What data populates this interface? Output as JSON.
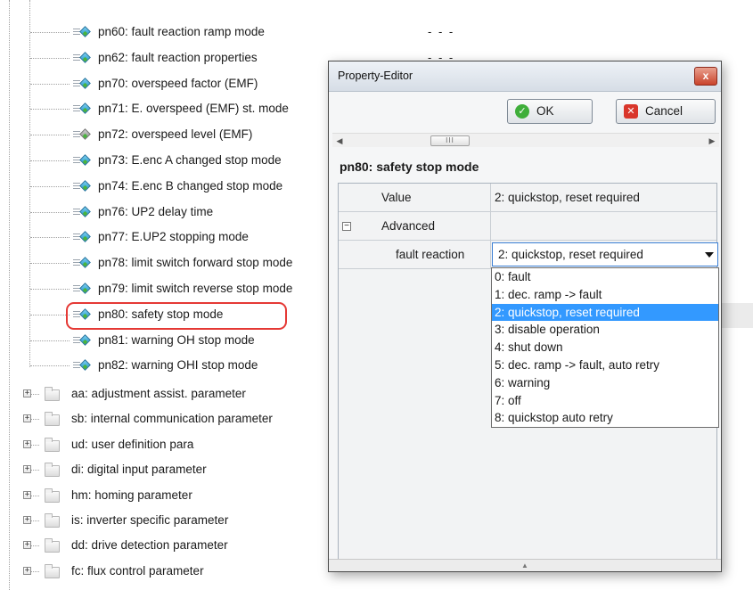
{
  "tree": {
    "param_items": [
      {
        "label": "pn60: fault reaction ramp mode",
        "value": "- - -",
        "icon": "parameter-icon"
      },
      {
        "label": "pn62: fault reaction properties",
        "value": "- - -",
        "icon": "parameter-icon"
      },
      {
        "label": "pn70: overspeed factor (EMF)",
        "icon": "parameter-icon"
      },
      {
        "label": "pn71: E. overspeed (EMF) st. mode",
        "icon": "parameter-icon"
      },
      {
        "label": "pn72: overspeed level (EMF)",
        "icon": "parameter-grey-icon"
      },
      {
        "label": "pn73: E.enc A changed stop mode",
        "icon": "parameter-icon"
      },
      {
        "label": "pn74: E.enc B changed stop mode",
        "icon": "parameter-icon"
      },
      {
        "label": "pn76: UP2 delay time",
        "icon": "parameter-icon"
      },
      {
        "label": "pn77: E.UP2 stopping mode",
        "icon": "parameter-icon"
      },
      {
        "label": "pn78: limit switch forward stop mode",
        "icon": "parameter-icon"
      },
      {
        "label": "pn79: limit switch reverse stop mode",
        "icon": "parameter-icon"
      },
      {
        "label": "pn80: safety stop mode",
        "icon": "parameter-icon",
        "highlighted": true
      },
      {
        "label": "pn81: warning OH stop mode",
        "icon": "parameter-icon"
      },
      {
        "label": "pn82: warning OHI stop mode",
        "icon": "parameter-icon"
      }
    ],
    "groups": [
      {
        "label": "aa: adjustment assist. parameter",
        "expander": "+"
      },
      {
        "label": "sb: internal communication parameter",
        "expander": "+"
      },
      {
        "label": "ud: user definition para",
        "expander": "+"
      },
      {
        "label": "di: digital input parameter",
        "expander": "+"
      },
      {
        "label": "hm: homing parameter",
        "expander": "+"
      },
      {
        "label": "is: inverter specific parameter",
        "expander": "+"
      },
      {
        "label": "dd: drive detection parameter",
        "expander": "+"
      },
      {
        "label": "fc: flux control parameter",
        "expander": "+"
      }
    ]
  },
  "property_editor": {
    "title": "Property-Editor",
    "close_glyph": "x",
    "ok_label": "OK",
    "ok_glyph": "✓",
    "cancel_label": "Cancel",
    "cancel_glyph": "✕",
    "scroll_left_glyph": "◀",
    "scroll_right_glyph": "▶",
    "scroll_thumb_glyph": "III",
    "heading": "pn80: safety stop mode",
    "grid": {
      "value_label": "Value",
      "value": "2: quickstop, reset required",
      "advanced_label": "Advanced",
      "collapse_glyph": "−",
      "fault_reaction_label": "fault reaction",
      "fault_reaction_value": "2: quickstop, reset required"
    },
    "dropdown_options": [
      "0: fault",
      "1: dec. ramp -> fault",
      "2: quickstop, reset required",
      "3: disable operation",
      "4: shut down",
      "5: dec. ramp -> fault, auto retry",
      "6: warning",
      "7: off",
      "8: quickstop auto retry"
    ],
    "selected_option_index": 2,
    "grip_glyph": "▲"
  },
  "colors": {
    "highlight_ring": "#e53935",
    "selection": "#3399ff",
    "ok_icon": "#3fae3a",
    "cancel_icon": "#d9362b"
  }
}
